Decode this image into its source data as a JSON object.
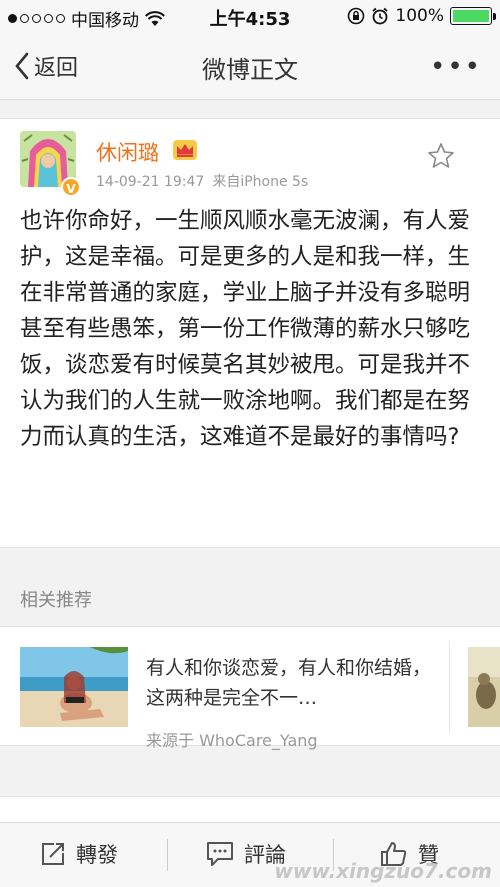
{
  "status": {
    "carrier": "中国移动",
    "time": "上午4:53",
    "battery": "100%",
    "battery_level": 1.0
  },
  "nav": {
    "back_label": "返回",
    "title": "微博正文",
    "more_label": "•••"
  },
  "post": {
    "author": "休闲璐",
    "time": "14-09-21 19:47",
    "source": "来自iPhone 5s",
    "text": "也许你命好，一生顺风顺水毫无波澜，有人爱护，这是幸福。可是更多的人是和我一样，生在非常普通的家庭，学业上脑子并没有多聪明甚至有些愚笨，第一份工作微薄的薪水只够吃饭，谈恋爱有时候莫名其妙被甩。可是我并不认为我们的人生就一败涂地啊。我们都是在努力而认真的生活，这难道不是最好的事情吗?"
  },
  "related": {
    "header": "相关推荐",
    "item": {
      "text": "有人和你谈恋爱，有人和你结婚，这两种是完全不一…",
      "source": "来源于 WhoCare_Yang"
    }
  },
  "toolbar": {
    "repost_label": "轉發",
    "comment_label": "評論",
    "like_label": "贊"
  },
  "watermark": "www.xingzuo7.com",
  "colors": {
    "username": "#f0711b",
    "verified_badge": "#f5a623",
    "battery": "#4cd964"
  }
}
